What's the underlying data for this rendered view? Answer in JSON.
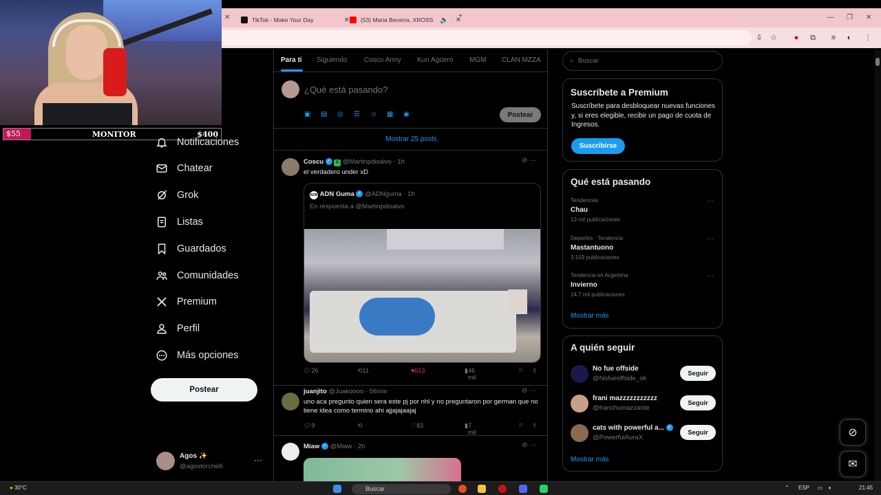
{
  "browser": {
    "tabs": [
      {
        "label": "TikTok - Make Your Day"
      },
      {
        "label": "(53) Maria Becerra, XROSS"
      }
    ]
  },
  "overlay": {
    "monitor_start": "$55",
    "monitor_label": "MONITOR",
    "monitor_end": "$400"
  },
  "nav": {
    "items": [
      {
        "label": "Notificaciones",
        "icon": "bell-icon"
      },
      {
        "label": "Chatear",
        "icon": "mail-icon"
      },
      {
        "label": "Grok",
        "icon": "grok-icon"
      },
      {
        "label": "Listas",
        "icon": "list-icon"
      },
      {
        "label": "Guardados",
        "icon": "bookmark-icon"
      },
      {
        "label": "Comunidades",
        "icon": "people-icon"
      },
      {
        "label": "Premium",
        "icon": "x-logo-icon"
      },
      {
        "label": "Perfil",
        "icon": "person-icon"
      },
      {
        "label": "Más opciones",
        "icon": "more-circle-icon"
      }
    ],
    "post_button": "Postear",
    "account_name": "Agos ✨",
    "account_handle": "@agostorchelli"
  },
  "feed": {
    "tabs": [
      "Para ti",
      "Siguiendo",
      "Coscu Army",
      "Kun Agüero",
      "MGM",
      "CLAN MZZA"
    ],
    "compose_placeholder": "¿Qué está pasando?",
    "compose_button": "Postear",
    "show_posts": "Mostrar 25 posts",
    "posts": [
      {
        "name": "Coscu",
        "handle": "@Martinpdisalvo",
        "time": "· 1h",
        "text": "el verdadero under xD",
        "quote_name": "ADN Guma",
        "quote_handle": "@ADNguma",
        "quote_time": "· 1h",
        "quote_reply": "En respuesta a @Martinpdisalvo",
        "replies": "26",
        "reposts": "11",
        "likes": "613",
        "views": "46 mil"
      },
      {
        "name": "juanjito",
        "handle": "@Juakoooo",
        "time": "· 56min",
        "text": "uno aca pregunto quien sera este pj por nhl y no preguntaron por german que no tiene idea como termino ahi ajjajajaajaj",
        "replies": "9",
        "reposts": "",
        "likes": "83",
        "views": "7 mil"
      },
      {
        "name": "Miaw",
        "handle": "@Miaw",
        "time": "· 2h"
      }
    ]
  },
  "right": {
    "search_placeholder": "Buscar",
    "premium_title": "Suscríbete a Premium",
    "premium_desc": "Suscríbete para desbloquear nuevas funciones y, si eres elegible, recibir un pago de cuota de Ingresos.",
    "premium_button": "Suscribirse",
    "trends_title": "Qué está pasando",
    "trends": [
      {
        "context": "Tendencias",
        "name": "Chau",
        "posts": "13 mil publicaciones"
      },
      {
        "context": "Deportes · Tendencia",
        "name": "Mastantuono",
        "posts": "3.159 publicaciones"
      },
      {
        "context": "Tendencia en Argentina",
        "name": "Invierno",
        "posts": "14,7 mil publicaciones"
      }
    ],
    "trends_more": "Mostrar más",
    "follow_title": "A quién seguir",
    "follows": [
      {
        "name": "No fue offside",
        "handle": "@Nofueoffside_ok",
        "button": "Seguir"
      },
      {
        "name": "frani mazzzzzzzzzzz",
        "handle": "@franchumazzante",
        "button": "Seguir"
      },
      {
        "name": "cats with powerful a...",
        "handle": "@PowerfulAuraX",
        "button": "Seguir"
      }
    ],
    "follow_more": "Mostrar más"
  },
  "taskbar": {
    "weather": "30°C",
    "search": "Buscar",
    "lang": "ESP",
    "time": "21:45"
  },
  "colors": {
    "accent": "#1d9bf0",
    "like": "#f91880",
    "tabbar": "#f2c7cc"
  }
}
